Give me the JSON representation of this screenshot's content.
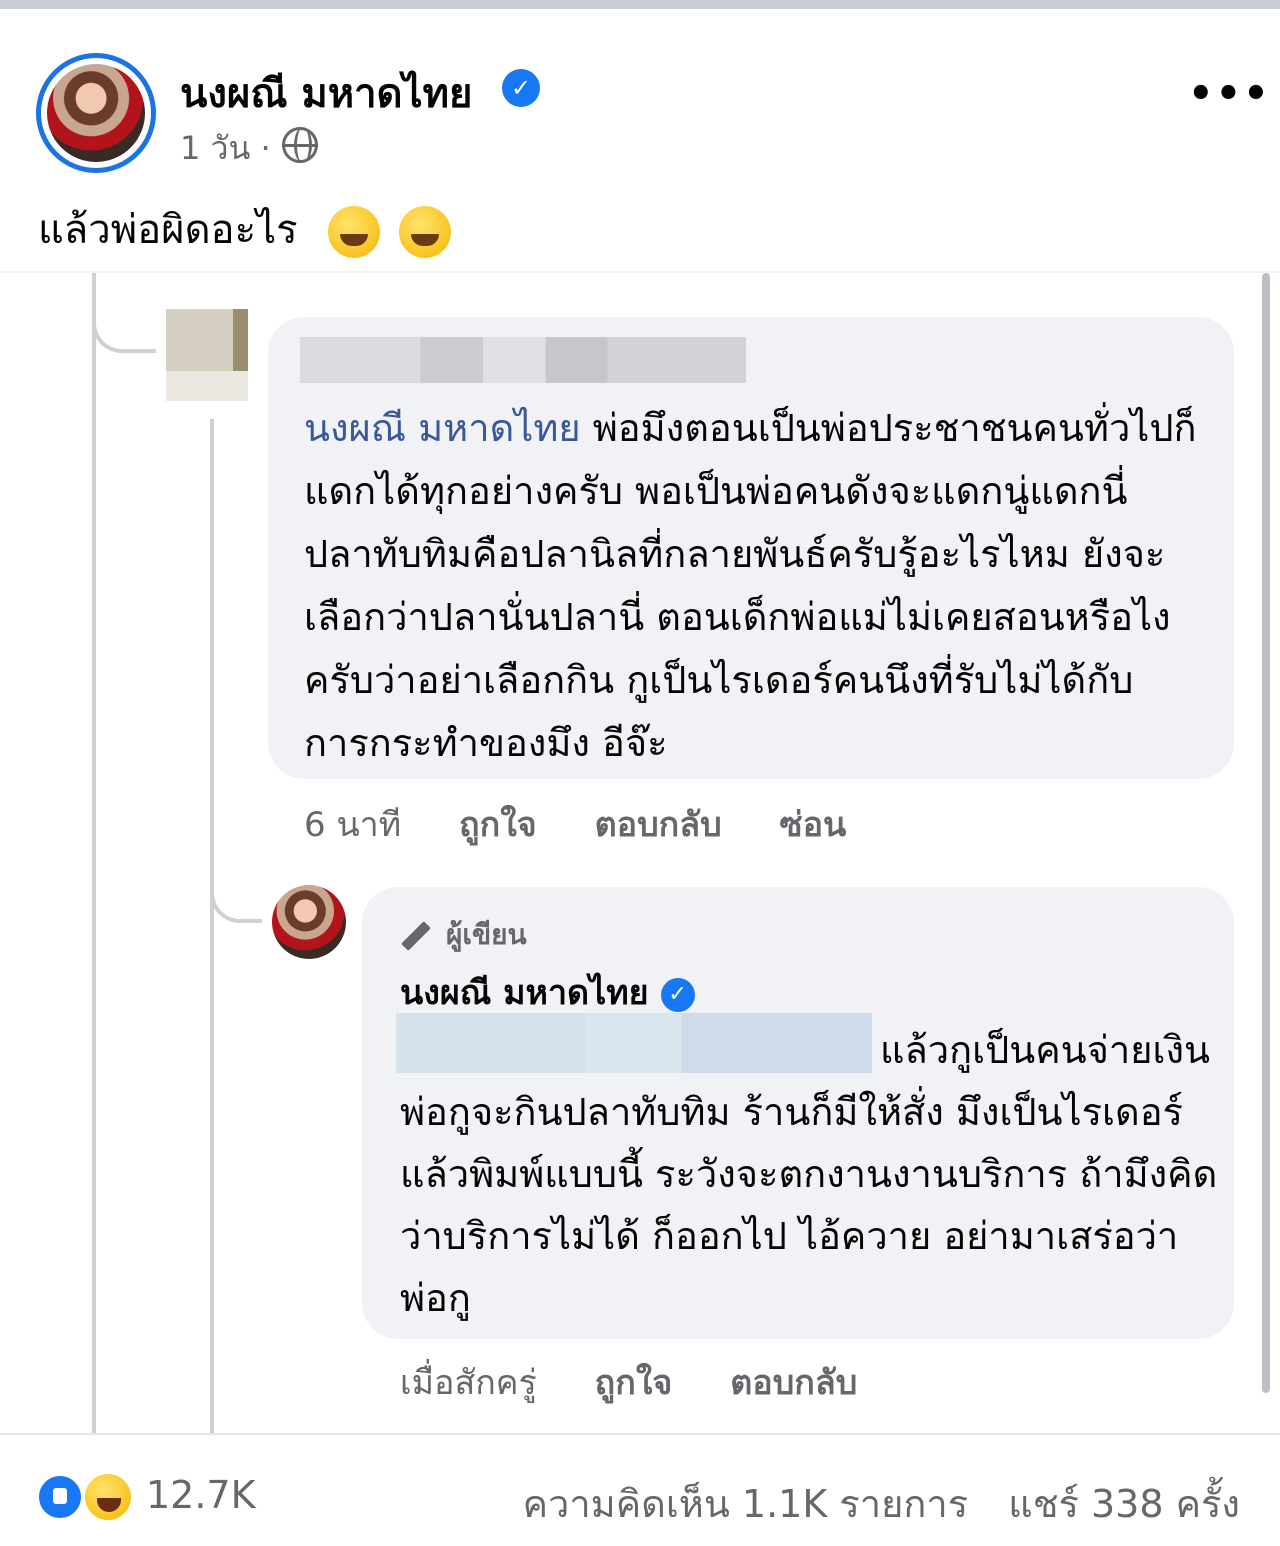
{
  "post": {
    "author": "นงผณี มหาดไทย",
    "time": "1 วัน",
    "separator": "·",
    "caption": "แล้วพ่อผิดอะไร",
    "more_label": "•••"
  },
  "comment": {
    "mention": "นงผณี มหาดไทย",
    "text": " พ่อมึงตอนเป็นพ่อประชาชนคนทั่วไปก็แดกได้ทุกอย่างครับ พอเป็นพ่อคนดังจะแดกนู่แดกนี่ ปลาทับทิมคือปลานิลที่กลายพันธ์ครับรู้อะไรไหม ยังจะเลือกว่าปลานั่นปลานี่ ตอนเด็กพ่อแม่ไม่เคยสอนหรือไงครับว่าอย่าเลือกกิน กูเป็นไรเดอร์คนนึงที่รับไม่ได้กับการกระทำของมึง อีจ๊ะ",
    "actions": {
      "time": "6 นาที",
      "like": "ถูกใจ",
      "reply": "ตอบกลับ",
      "hide": "ซ่อน"
    }
  },
  "reply": {
    "author_tag": "ผู้เขียน",
    "author": "นงผณี มหาดไทย",
    "text": "แล้วกูเป็นคนจ่ายเงิน พ่อกูจะกินปลาทับทิม ร้านก็มีให้สั่ง มึงเป็นไรเดอร์แล้วพิมพ์แบบนี้ ระวังจะตกงานงานบริการ ถ้ามึงคิดว่าบริการไม่ได้ ก็ออกไป ไอ้ควาย อย่ามาเสร่อว่าพ่อกู",
    "actions": {
      "time": "เมื่อสักครู่",
      "like": "ถูกใจ",
      "reply": "ตอบกลับ"
    }
  },
  "footer": {
    "reactions": "12.7K",
    "comments": "ความคิดเห็น 1.1K รายการ",
    "shares": "แชร์ 338 ครั้ง"
  },
  "colors": {
    "verified": "#1877f2",
    "mention": "#385898",
    "muted": "#65676b",
    "bubble": "#f0f2f5"
  },
  "icons": [
    "globe-icon",
    "verified-icon",
    "more-icon",
    "pen-icon",
    "like-icon",
    "haha-icon",
    "laughing-emoji",
    "rofl-emoji"
  ]
}
